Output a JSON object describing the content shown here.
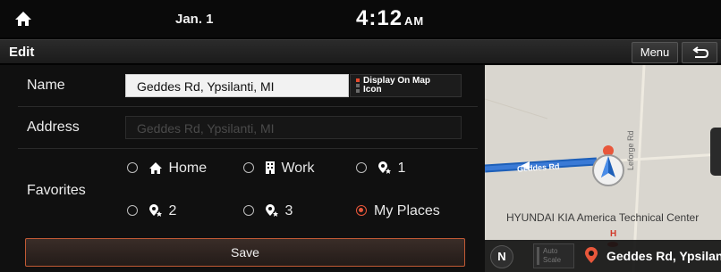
{
  "status_bar": {
    "date": "Jan. 1",
    "time": "4:12",
    "ampm": "AM",
    "home_icon": "home-icon"
  },
  "title_bar": {
    "title": "Edit",
    "menu_label": "Menu",
    "back_icon": "back-arrow-icon"
  },
  "form": {
    "name_label": "Name",
    "name_value": "Geddes Rd, Ypsilanti, MI",
    "display_on_map_line1": "Display On Map",
    "display_on_map_line2": "Icon",
    "address_label": "Address",
    "address_placeholder": "Geddes Rd, Ypsilanti, MI",
    "favorites_label": "Favorites",
    "options": [
      {
        "label": "Home",
        "icon": "home-icon",
        "checked": false
      },
      {
        "label": "Work",
        "icon": "building-icon",
        "checked": false
      },
      {
        "label": "1",
        "icon": "favorite-pin-icon",
        "checked": false
      },
      {
        "label": "2",
        "icon": "favorite-pin-icon",
        "checked": false
      },
      {
        "label": "3",
        "icon": "favorite-pin-icon",
        "checked": false
      },
      {
        "label": "My Places",
        "icon": "",
        "checked": true
      }
    ],
    "save_label": "Save"
  },
  "map": {
    "road_label": "Geddes Rd",
    "cross_road_label": "Leforge Rd",
    "poi_label": "HYUNDAI KIA America Technical Center",
    "north_label": "N",
    "autoscale_line1": "Auto",
    "autoscale_line2": "Scale",
    "destination": "Geddes Rd, Ypsilan"
  },
  "colors": {
    "accent": "#e8573b",
    "route_blue": "#1d5fb8"
  }
}
